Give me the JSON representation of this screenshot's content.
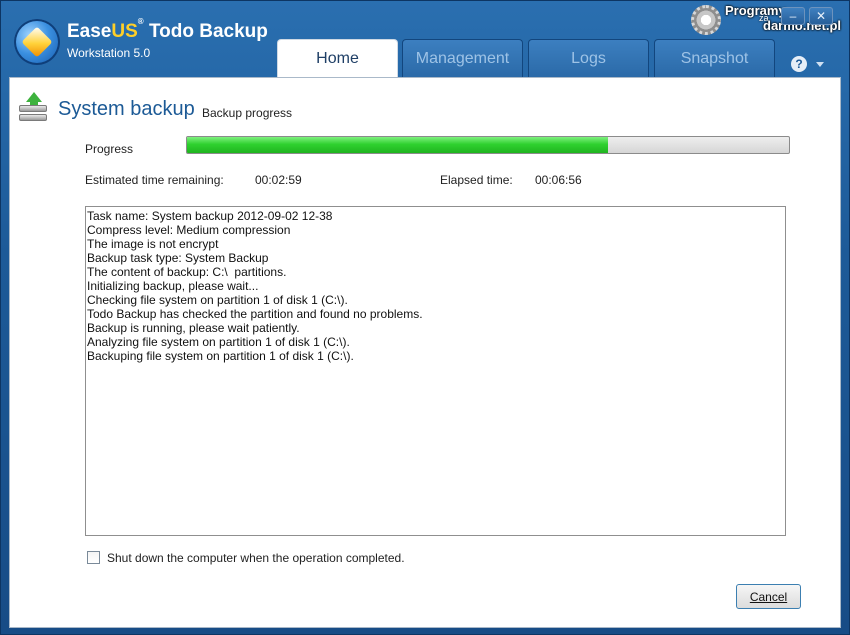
{
  "app": {
    "brand_ease": "Ease",
    "brand_us": "US",
    "brand_reg": "®",
    "brand_product": " Todo Backup",
    "edition": "Workstation 5.0"
  },
  "tabs": [
    {
      "label": "Home",
      "active": true
    },
    {
      "label": "Management",
      "active": false
    },
    {
      "label": "Logs",
      "active": false
    },
    {
      "label": "Snapshot",
      "active": false
    }
  ],
  "window_controls": {
    "minimize": "–",
    "close": "✕",
    "help": "?"
  },
  "watermark": {
    "line1": "Programy",
    "line2": "za",
    "line3": "darmo.net.pl"
  },
  "page": {
    "title": "System backup",
    "subtitle": "Backup progress",
    "icon": "backup-disk-icon"
  },
  "progress": {
    "label": "Progress",
    "fraction": 0.7,
    "estimated_label": "Estimated time remaining:",
    "estimated_value": "00:02:59",
    "elapsed_label": "Elapsed time:",
    "elapsed_value": "00:06:56"
  },
  "log_lines": [
    "Task name: System backup 2012-09-02 12-38",
    "Compress level: Medium compression",
    "The image is not encrypt",
    "Backup task type: System Backup",
    "The content of backup: C:\\  partitions.",
    "Initializing backup, please wait...",
    "Checking file system on partition 1 of disk 1 (C:\\).",
    "Todo Backup has checked the partition and found no problems.",
    "Backup is running, please wait patiently.",
    "Analyzing file system on partition 1 of disk 1 (C:\\).",
    "Backuping file system on partition 1 of disk 1 (C:\\)."
  ],
  "shutdown_option": {
    "label": "Shut down the computer when the operation completed.",
    "checked": false
  },
  "cancel_label": "Cancel",
  "colors": {
    "accent": "#1d5a98",
    "progress": "#2fd12f",
    "title": "#1c5a96"
  }
}
